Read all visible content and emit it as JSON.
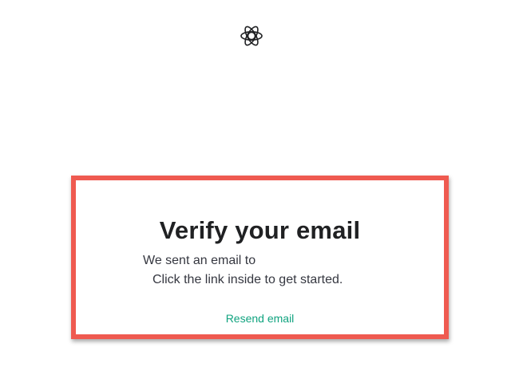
{
  "brand": {
    "logo_icon": "openai-knot-icon"
  },
  "verify": {
    "title": "Verify your email",
    "sent_text": "We sent an email to",
    "instructions": "Click the link inside to get started.",
    "resend_label": "Resend email"
  },
  "colors": {
    "highlight_border": "#ef5a50",
    "link": "#10a37f",
    "heading": "#202123",
    "body_text": "#353740"
  }
}
